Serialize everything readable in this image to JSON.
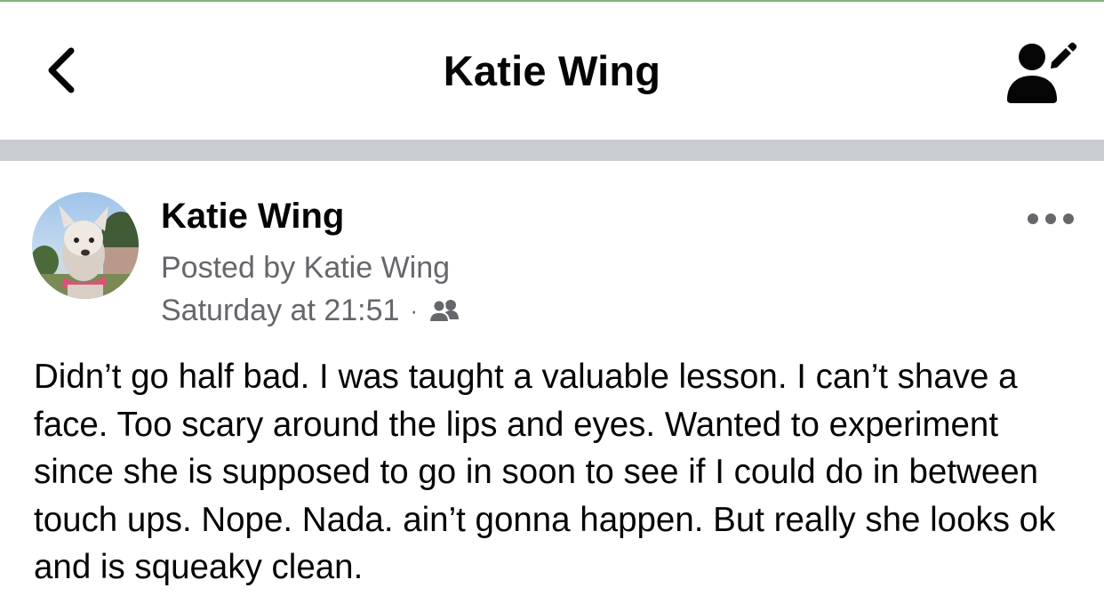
{
  "nav": {
    "title": "Katie Wing",
    "back_icon": "chevron-left-icon",
    "edit_icon": "profile-edit-icon"
  },
  "post": {
    "author": "Katie Wing",
    "posted_by": "Posted by Katie Wing",
    "timestamp": "Saturday at 21:51",
    "separator": "·",
    "audience_icon": "friends-icon",
    "more_icon": "more-horizontal-icon",
    "body": "Didn’t go half bad. I was taught a valuable lesson. I can’t shave a face. Too scary around the lips and eyes. Wanted to experiment since she is supposed to go in soon to see if I could do in between touch ups. Nope. Nada. ain’t gonna happen.  But really she looks ok and is squeaky clean."
  },
  "colors": {
    "accent_top": "#7cb47c",
    "divider": "#c9ccd1",
    "secondary_text": "#65676b",
    "primary_text": "#050505"
  }
}
